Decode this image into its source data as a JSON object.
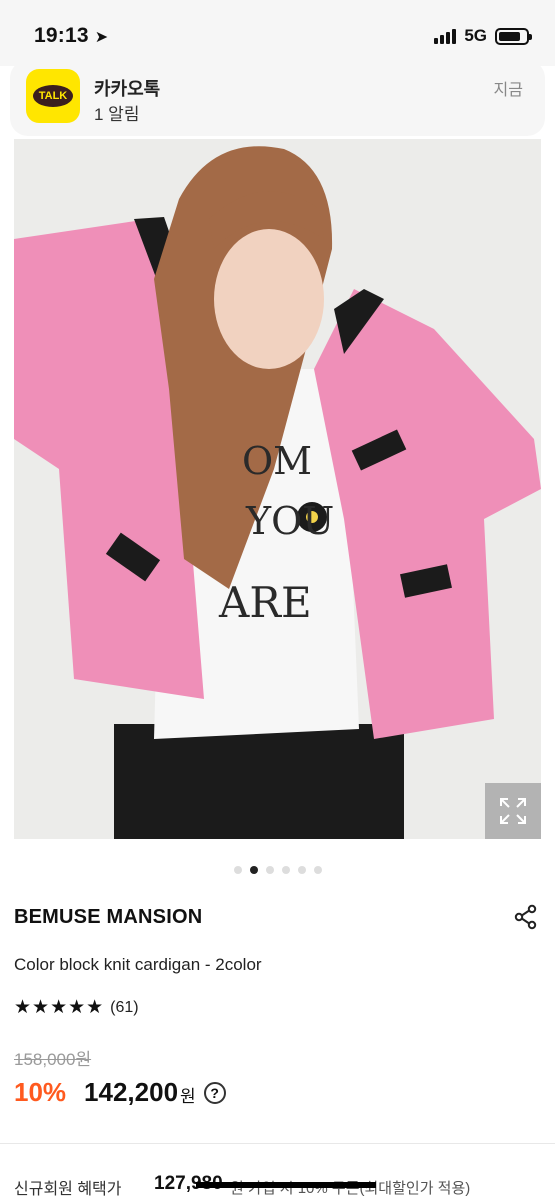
{
  "status_bar": {
    "time": "19:13",
    "network": "5G",
    "battery_level": 0.8,
    "signal_bars": 4
  },
  "notification": {
    "app_logo_text": "TALK",
    "app_name": "카카오톡",
    "body": "1 알림",
    "time": "지금"
  },
  "product_image": {
    "shirt_text_lines": [
      "OM",
      "YOU",
      "ARE"
    ],
    "page_count": 6,
    "current_page_index": 1
  },
  "product": {
    "brand": "BEMUSE MANSION",
    "name": "Color block knit cardigan - 2color",
    "stars": "★★★★★",
    "review_count": "(61)",
    "original_price": "158,000원",
    "discount": "10%",
    "sale_price": "142,200",
    "currency": "원",
    "help_symbol": "?"
  },
  "member_benefit": {
    "label": "신규회원 혜택가",
    "price": "127,980",
    "note": "원 가입 시 10% 쿠폰(최대할인가 적용)"
  },
  "colors": {
    "accent_discount": "#ff5a1f",
    "kakao_yellow": "#ffe600",
    "cardigan_pink": "#ef8fb8"
  },
  "icons": {
    "location": "location-arrow-icon",
    "share": "share-icon",
    "expand": "expand-icon",
    "help": "question-circle-icon"
  }
}
